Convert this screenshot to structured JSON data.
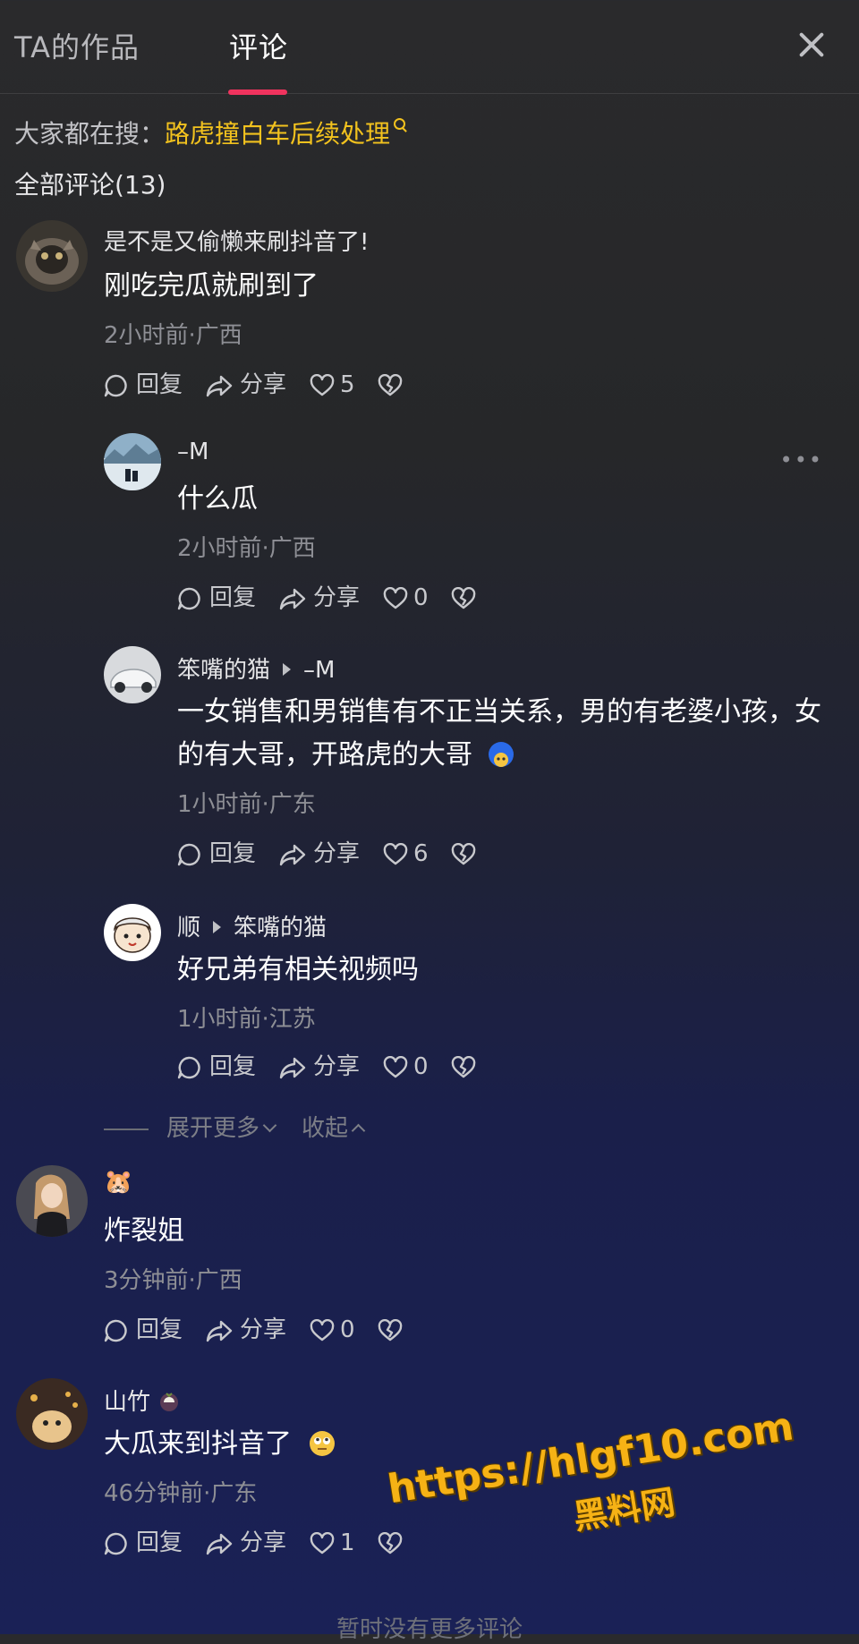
{
  "tabs": {
    "works": "TA的作品",
    "comments": "评论"
  },
  "search": {
    "prefix": "大家都在搜：",
    "link": "路虎撞白车后续处理"
  },
  "comments_header": "全部评论(13)",
  "actions": {
    "reply": "回复",
    "share": "分享"
  },
  "comments": [
    {
      "name": "是不是又偷懒来刷抖音了!",
      "text": "刚吃完瓜就刷到了",
      "meta": "2小时前·广西",
      "likes": "5"
    },
    {
      "name": "–M",
      "text": "什么瓜",
      "meta": "2小时前·广西",
      "likes": "0"
    },
    {
      "name": "笨嘴的猫",
      "reply_to": "–M",
      "text_line1": "一女销售和男销售有不正当关系，男的有老婆小孩，女",
      "text_line2": "的有大哥，开路虎的大哥",
      "meta": "1小时前·广东",
      "likes": "6"
    },
    {
      "name": "顺",
      "reply_to": "笨嘴的猫",
      "text": "好兄弟有相关视频吗",
      "meta": "1小时前·江苏",
      "likes": "0"
    },
    {
      "name": "🐹",
      "text": "炸裂姐",
      "meta": "3分钟前·广西",
      "likes": "0"
    },
    {
      "name": "山竹",
      "text": "大瓜来到抖音了",
      "meta": "46分钟前·广东",
      "likes": "1"
    }
  ],
  "expand": {
    "more": "展开更多",
    "collapse": "收起"
  },
  "footer": "暂时没有更多评论",
  "watermark": {
    "url": "https://hlgf10.com",
    "name": "黑料网"
  }
}
